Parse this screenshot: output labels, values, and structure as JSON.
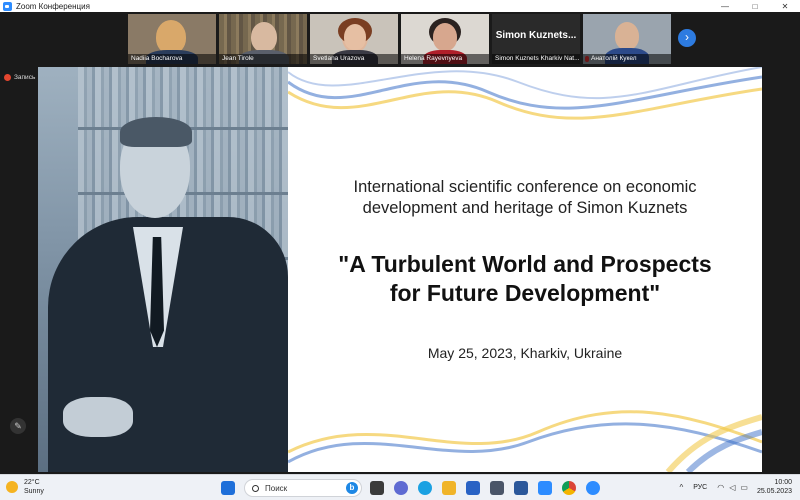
{
  "window": {
    "title": "Zoom Конференция",
    "min": "—",
    "max": "□",
    "close": "✕"
  },
  "participants": [
    {
      "name": "Nadiia Bocharova"
    },
    {
      "name": "Jean Tirole"
    },
    {
      "name": "Svetlana Urazova"
    },
    {
      "name": "Helena Rayevnyeva"
    },
    {
      "name": "Simon Kuznets Kharkiv Nat...",
      "display": "Simon  Kuznets..."
    },
    {
      "name": "Анатолій Кукел"
    }
  ],
  "strip_next": "›",
  "recording": {
    "label": "Запись"
  },
  "slide": {
    "conference_line1": "International scientific conference on economic",
    "conference_line2": "development and heritage of Simon Kuznets",
    "headline_line1": "\"A Turbulent World and Prospects",
    "headline_line2": "for Future Development\"",
    "date": "May 25, 2023, Kharkiv, Ukraine"
  },
  "pen_icon": "✎",
  "taskbar": {
    "weather_temp": "22°C",
    "weather_desc": "Sunny",
    "search_placeholder": "Поиск",
    "search_bing": "b",
    "tray_chevron": "^",
    "language": "РУС",
    "time": "10:00",
    "date": "25.05.2023"
  },
  "colors": {
    "zoom_blue": "#2d8cff",
    "wave_blue": "#3b6fc7",
    "wave_yellow": "#f2c94c",
    "record_red": "#e4462f"
  }
}
